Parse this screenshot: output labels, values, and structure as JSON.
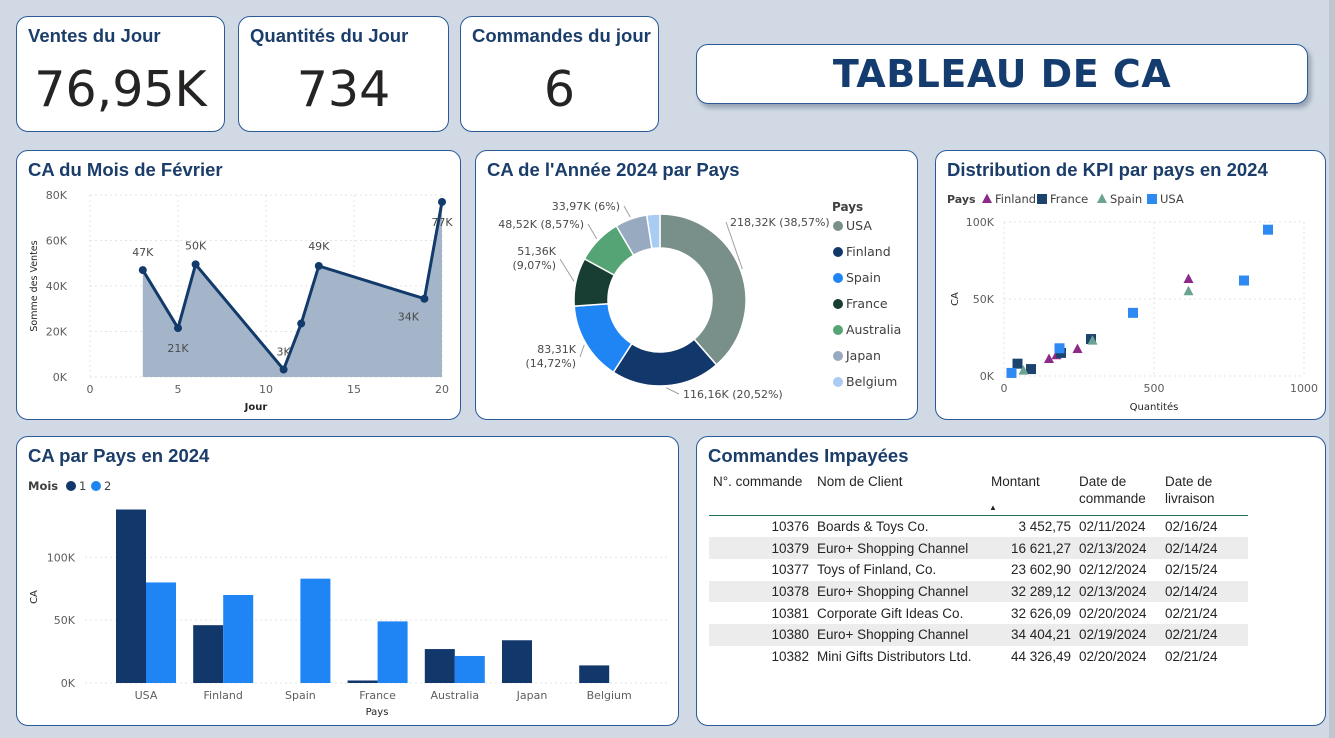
{
  "kpis": [
    {
      "title": "Ventes du Jour",
      "value": "76,95K"
    },
    {
      "title": "Quantités du Jour",
      "value": "734"
    },
    {
      "title": "Commandes du jour",
      "value": "6"
    }
  ],
  "banner": {
    "title": "TABLEAU DE CA"
  },
  "cards": {
    "line_title": "CA du Mois de Février",
    "donut_title": "CA de l'Année 2024 par Pays",
    "scatter_title": "Distribution de KPI par pays en 2024",
    "bar_title": "CA par Pays en 2024",
    "table_title": "Commandes Impayées"
  },
  "chart_data": [
    {
      "type": "area",
      "title": "CA du Mois de Février",
      "xlabel": "Jour",
      "ylabel": "Somme des Ventes",
      "xlim": [
        0,
        20
      ],
      "ylim": [
        0,
        80000
      ],
      "xticks": [
        0,
        5,
        10,
        15,
        20
      ],
      "yticks": [
        0,
        20000,
        40000,
        60000,
        80000
      ],
      "ytick_labels": [
        "0K",
        "20K",
        "40K",
        "60K",
        "80K"
      ],
      "x": [
        3,
        5,
        6,
        11,
        12,
        13,
        19,
        20
      ],
      "values": [
        47000,
        21500,
        49500,
        3300,
        23500,
        48800,
        34400,
        76950
      ],
      "labels": [
        "47K",
        "21K",
        "50K",
        "3K",
        "",
        "49K",
        "34K",
        "77K"
      ],
      "color": "#123a6b",
      "fill": "#a0b1c6",
      "grid": true
    },
    {
      "type": "pie",
      "title": "CA de l'Année 2024 par Pays",
      "legend_title": "Pays",
      "legend_position": "right",
      "categories": [
        "USA",
        "Finland",
        "Spain",
        "France",
        "Australia",
        "Japan",
        "Belgium"
      ],
      "values": [
        218320,
        116160,
        83310,
        51360,
        48520,
        33970,
        14000
      ],
      "labels": [
        "218,32K (38,57%)",
        "116,16K (20,52%)",
        "83,31K (14,72%)",
        "51,36K (9,07%)",
        "48,52K (8,57%)",
        "33,97K (6%)",
        ""
      ],
      "colors": [
        "#798f8a",
        "#12386b",
        "#1f85f5",
        "#183e33",
        "#55a476",
        "#98aac0",
        "#a9ccf5"
      ]
    },
    {
      "type": "scatter",
      "title": "Distribution de KPI par pays en 2024",
      "xlabel": "Quantités",
      "ylabel": "CA",
      "xlim": [
        0,
        1000
      ],
      "ylim": [
        0,
        100000
      ],
      "xticks": [
        0,
        500,
        1000
      ],
      "yticks": [
        0,
        50000,
        100000
      ],
      "ytick_labels": [
        "0K",
        "50K",
        "100K"
      ],
      "legend_title": "Pays",
      "legend_position": "top-left",
      "series": [
        {
          "name": "Finland",
          "color": "#8b2b87",
          "marker": "triangle",
          "points": [
            [
              150,
              11000
            ],
            [
              175,
              13500
            ],
            [
              245,
              17500
            ],
            [
              615,
              63000
            ]
          ]
        },
        {
          "name": "France",
          "color": "#1c426e",
          "marker": "square",
          "points": [
            [
              45,
              8000
            ],
            [
              90,
              4500
            ],
            [
              190,
              15000
            ],
            [
              290,
              24000
            ]
          ]
        },
        {
          "name": "Spain",
          "color": "#6aa38f",
          "marker": "triangle",
          "points": [
            [
              65,
              3500
            ],
            [
              295,
              23000
            ],
            [
              615,
              55000
            ]
          ]
        },
        {
          "name": "USA",
          "color": "#2f89f2",
          "marker": "square",
          "points": [
            [
              25,
              2000
            ],
            [
              185,
              18000
            ],
            [
              430,
              41000
            ],
            [
              800,
              62000
            ],
            [
              880,
              95000
            ]
          ]
        }
      ],
      "grid": true
    },
    {
      "type": "bar",
      "title": "CA par Pays en 2024",
      "xlabel": "Pays",
      "ylabel": "CA",
      "legend_title": "Mois",
      "legend_position": "top-left",
      "ylim": [
        0,
        140000
      ],
      "yticks": [
        0,
        50000,
        100000
      ],
      "ytick_labels": [
        "0K",
        "50K",
        "100K"
      ],
      "categories": [
        "USA",
        "Finland",
        "Spain",
        "France",
        "Australia",
        "Japan",
        "Belgium"
      ],
      "series": [
        {
          "name": "1",
          "color": "#12386b",
          "values": [
            138000,
            46000,
            0,
            2000,
            27000,
            34000,
            14000
          ]
        },
        {
          "name": "2",
          "color": "#1f85f5",
          "values": [
            80000,
            70000,
            83000,
            49000,
            21500,
            0,
            0
          ]
        }
      ],
      "grid": true
    }
  ],
  "table": {
    "columns": [
      "N°. commande",
      "Nom de Client",
      "Montant",
      "Date de commande",
      "Date de livraison"
    ],
    "sort_icon": "sort-down-icon",
    "rows": [
      [
        "10376",
        "Boards & Toys Co.",
        "3 452,75",
        "02/11/2024",
        "02/16/24"
      ],
      [
        "10379",
        "Euro+ Shopping Channel",
        "16 621,27",
        "02/13/2024",
        "02/14/24"
      ],
      [
        "10377",
        "Toys of Finland, Co.",
        "23 602,90",
        "02/12/2024",
        "02/15/24"
      ],
      [
        "10378",
        "Euro+ Shopping Channel",
        "32 289,12",
        "02/13/2024",
        "02/14/24"
      ],
      [
        "10381",
        "Corporate Gift Ideas Co.",
        "32 626,09",
        "02/20/2024",
        "02/21/24"
      ],
      [
        "10380",
        "Euro+ Shopping Channel",
        "34 404,21",
        "02/19/2024",
        "02/21/24"
      ],
      [
        "10382",
        "Mini Gifts Distributors Ltd.",
        "44 326,49",
        "02/20/2024",
        "02/21/24"
      ]
    ]
  }
}
